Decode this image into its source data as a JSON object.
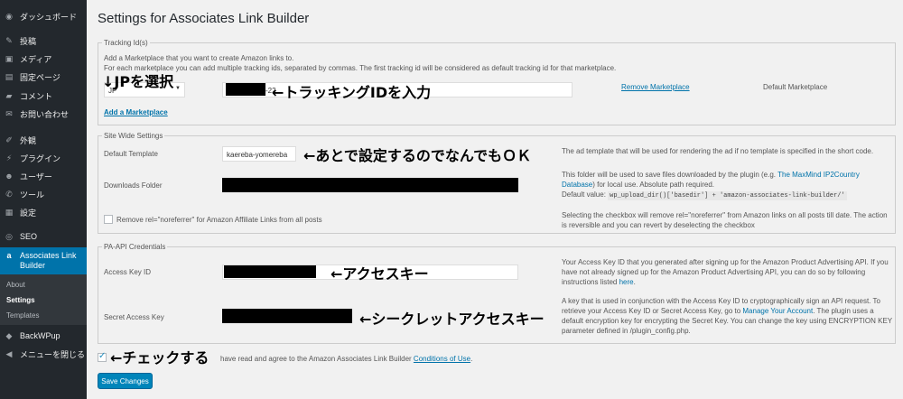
{
  "sidebar": {
    "items": [
      {
        "label": "ダッシュボード",
        "icon": "dashboard-icon"
      },
      {
        "label": "投稿",
        "icon": "pin-icon"
      },
      {
        "label": "メディア",
        "icon": "media-icon"
      },
      {
        "label": "固定ページ",
        "icon": "pages-icon"
      },
      {
        "label": "コメント",
        "icon": "comments-icon"
      },
      {
        "label": "お問い合わせ",
        "icon": "mail-icon"
      },
      {
        "label": "外観",
        "icon": "appearance-icon"
      },
      {
        "label": "プラグイン",
        "icon": "plugins-icon"
      },
      {
        "label": "ユーザー",
        "icon": "users-icon"
      },
      {
        "label": "ツール",
        "icon": "tools-icon"
      },
      {
        "label": "設定",
        "icon": "settings-icon"
      },
      {
        "label": "SEO",
        "icon": "seo-icon"
      },
      {
        "label": "Associates Link Builder",
        "icon": "amazon-icon"
      },
      {
        "label": "BackWPup",
        "icon": "backwpup-icon"
      },
      {
        "label": "メニューを閉じる",
        "icon": "collapse-icon"
      }
    ],
    "submenu": [
      "About",
      "Settings",
      "Templates"
    ]
  },
  "page": {
    "title": "Settings for Associates Link Builder"
  },
  "tracking": {
    "legend": "Tracking Id(s)",
    "desc1": "Add a Marketplace that you want to create Amazon links to.",
    "desc2": "For each marketplace you can add multiple tracking ids, separated by commas. The first tracking id will be considered as default tracking id for that marketplace.",
    "marketplace_value": "JP",
    "tracking_suffix": "-22",
    "remove_link": "Remove Marketplace",
    "default_label": "Default Marketplace",
    "add_link": "Add a Marketplace"
  },
  "site": {
    "legend": "Site Wide Settings",
    "template_label": "Default Template",
    "template_value": "kaereba-yomereba",
    "template_desc": "The ad template that will be used for rendering the ad if no template is specified in the short code.",
    "downloads_label": "Downloads Folder",
    "downloads_desc1": "This folder will be used to save files downloaded by the plugin (e.g. ",
    "downloads_desc_link": "The MaxMind IP2Country Database",
    "downloads_desc2": ") for local use. Absolute path required.",
    "default_value_label": "Default value:",
    "default_value_code": "wp_upload_dir()['basedir'] + 'amazon-associates-link-builder/'",
    "noreferrer_label": "Remove rel=\"noreferrer\" for Amazon Affiliate Links from all posts",
    "noreferrer_desc": "Selecting the checkbox will remove rel=\"noreferrer\" from Amazon links on all posts till date. The action is reversible and you can revert by deselecting the checkbox"
  },
  "paapi": {
    "legend": "PA-API Credentials",
    "access_label": "Access Key ID",
    "access_desc1": "Your Access Key ID that you generated after signing up for the Amazon Product Advertising API. If you have not already signed up for the Amazon Product Advertising API, you can do so by following instructions listed ",
    "access_desc_link": "here",
    "access_desc_end": ".",
    "secret_label": "Secret Access Key",
    "secret_desc1": "A key that is used in conjunction with the Access Key ID to cryptographically sign an API request. To retrieve your Access Key ID or Secret Access Key, go to ",
    "secret_desc_link": "Manage Your Account",
    "secret_desc2": ". The plugin uses a default encryption key for encrypting the Secret Key. You can change the key using ENCRYPTION KEY parameter defined in /plugin_config.php."
  },
  "terms": {
    "text": "have read and agree to the Amazon Associates Link Builder ",
    "link": "Conditions of Use",
    "end": "."
  },
  "save_button": "Save Changes",
  "annotations": {
    "jp": "↓JPを選択",
    "tracking": "←トラッキングIDを入力",
    "template": "←あとで設定するのでなんでもＯＫ",
    "access": "←アクセスキー",
    "secret": "←シークレットアクセスキー",
    "check": "←チェックする"
  },
  "colors": {
    "sidebar": "#23282d",
    "active": "#0073aa",
    "link": "#0073aa",
    "button": "#0085ba"
  }
}
